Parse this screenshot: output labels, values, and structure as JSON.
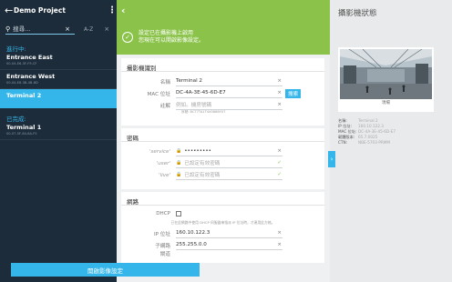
{
  "sidebar": {
    "title": "Demo Project",
    "search": {
      "placeholder": "搜尋...",
      "sort_label": "A-Z"
    },
    "sections": [
      {
        "label": "進行中:",
        "devices": [
          {
            "name": "Entrance East",
            "mac": "00-04-E6-3F-F9-CF",
            "selected": false
          },
          {
            "name": "Entrance West",
            "mac": "00-04-E6-3B-4B-8D",
            "selected": false
          },
          {
            "name": "Terminal 2",
            "mac": "",
            "selected": true
          }
        ]
      },
      {
        "label": "已完成:",
        "devices": [
          {
            "name": "Terminal 1",
            "mac": "00-07-5F-84-8A-F5",
            "selected": false
          }
        ]
      }
    ]
  },
  "main": {
    "notice": {
      "line1": "設定已在攝影機上啟用",
      "line2": "您現在可以開啟影像設定。"
    },
    "camera_id": {
      "heading": "攝影機識別",
      "name_label": "名稱",
      "name_value": "Terminal 2",
      "mac_label": "MAC 位址",
      "mac_value": "DC-4A-3E-45-6D-E7",
      "search_button": "搜索",
      "note_label": "註解",
      "note_placeholder": "例如。機房號碼",
      "serial_sub": "序號: BCT7TA1T4X5886Y07"
    },
    "password": {
      "heading": "密碼",
      "rows": [
        {
          "label": "'service'",
          "value": "•••••••••"
        },
        {
          "label": "'user'",
          "value": "已設定有效密碼"
        },
        {
          "label": "'live'",
          "value": "已設定有效密碼"
        }
      ]
    },
    "network": {
      "heading": "網路",
      "dhcp_label": "DHCP",
      "dhcp_hint": "已在此網路中使用 DHCP 伺服器來指派 IP 位址時，才連用此方格。",
      "ip_label": "IP 位址",
      "ip_value": "160.10.122.3",
      "subnet_label": "子網路",
      "subnet_value": "255.255.0.0",
      "gateway_label": "閘道"
    },
    "start_button": "開啟影像設定"
  },
  "right_panel": {
    "title": "攝影機狀態",
    "preview_caption": "現場",
    "info": [
      {
        "key": "名稱:",
        "value": "Terminal 2"
      },
      {
        "key": "IP 位址:",
        "value": "160.10.122.3"
      },
      {
        "key": "MAC 位址:",
        "value": "DC-4A-3E-45-6D-E7"
      },
      {
        "key": "韌體版本:",
        "value": "65.7.0025"
      },
      {
        "key": "CTN:",
        "value": "NBE-5703-PRMM"
      }
    ]
  },
  "colors": {
    "sidebar_bg": "#1d2c3a",
    "accent": "#35b6ea",
    "success": "#8bc34a",
    "main_bg": "#eef0f1",
    "panel_bg": "#e9eaeb"
  },
  "icons": [
    "back-arrow-icon",
    "kebab-menu-icon",
    "search-icon",
    "clear-icon",
    "sort-icon",
    "add-icon",
    "remove-icon",
    "share-icon",
    "check-circle-icon",
    "lock-icon",
    "collapse-chevron-icon"
  ]
}
